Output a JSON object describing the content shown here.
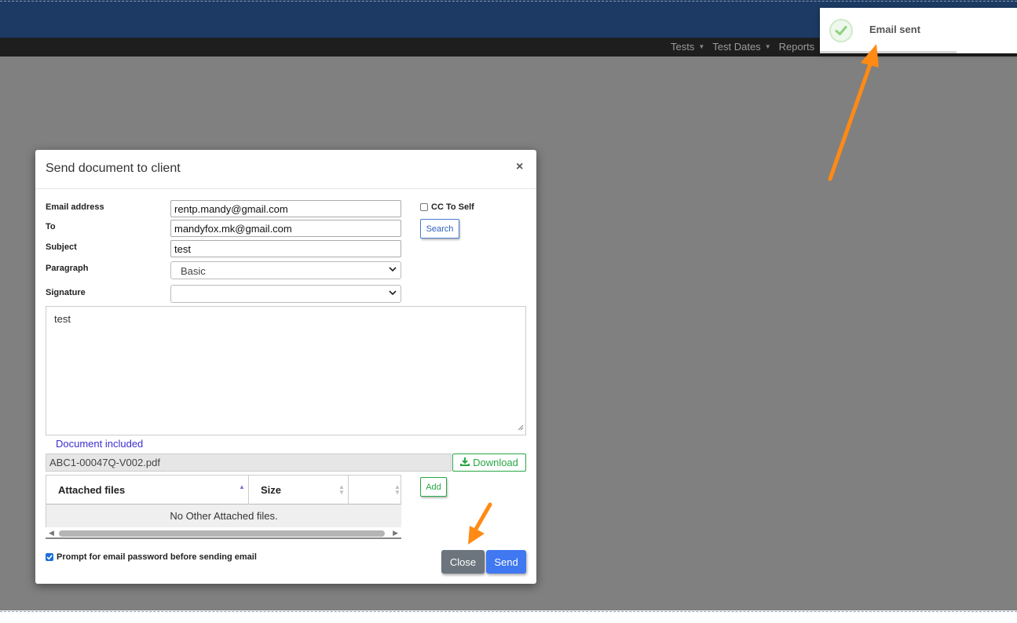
{
  "nav": {
    "items": [
      {
        "label": "Tests"
      },
      {
        "label": "Test Dates"
      },
      {
        "label": "Reports"
      }
    ]
  },
  "toast": {
    "message": "Email sent",
    "icon": "check-circle-icon"
  },
  "modal": {
    "title": "Send document to client",
    "close_glyph": "×",
    "fields": {
      "email_address": {
        "label": "Email address",
        "value": "rentp.mandy@gmail.com"
      },
      "to": {
        "label": "To",
        "value": "mandyfox.mk@gmail.com"
      },
      "subject": {
        "label": "Subject",
        "value": "test"
      },
      "paragraph": {
        "label": "Paragraph",
        "value": "Basic"
      },
      "signature": {
        "label": "Signature",
        "value": ""
      }
    },
    "cc_to_self": {
      "label": "CC To Self",
      "checked": false
    },
    "search_button": "Search",
    "body_text": "test",
    "document_included_label": "Document included",
    "document_file": "ABC1-00047Q-V002.pdf",
    "download_button": "Download",
    "attached_table": {
      "columns": [
        "Attached files",
        "Size",
        ""
      ],
      "empty_message": "No Other Attached files."
    },
    "add_button": "Add",
    "prompt_password": {
      "label": "Prompt for email password before sending email",
      "checked": true
    },
    "close_button": "Close",
    "send_button": "Send"
  },
  "colors": {
    "header_bg": "#1c3a63",
    "overlay": "#808080",
    "send_btn": "#3f78f0",
    "close_btn": "#6c757d",
    "success": "#28a745",
    "annotation_arrow": "#ff8a14"
  }
}
